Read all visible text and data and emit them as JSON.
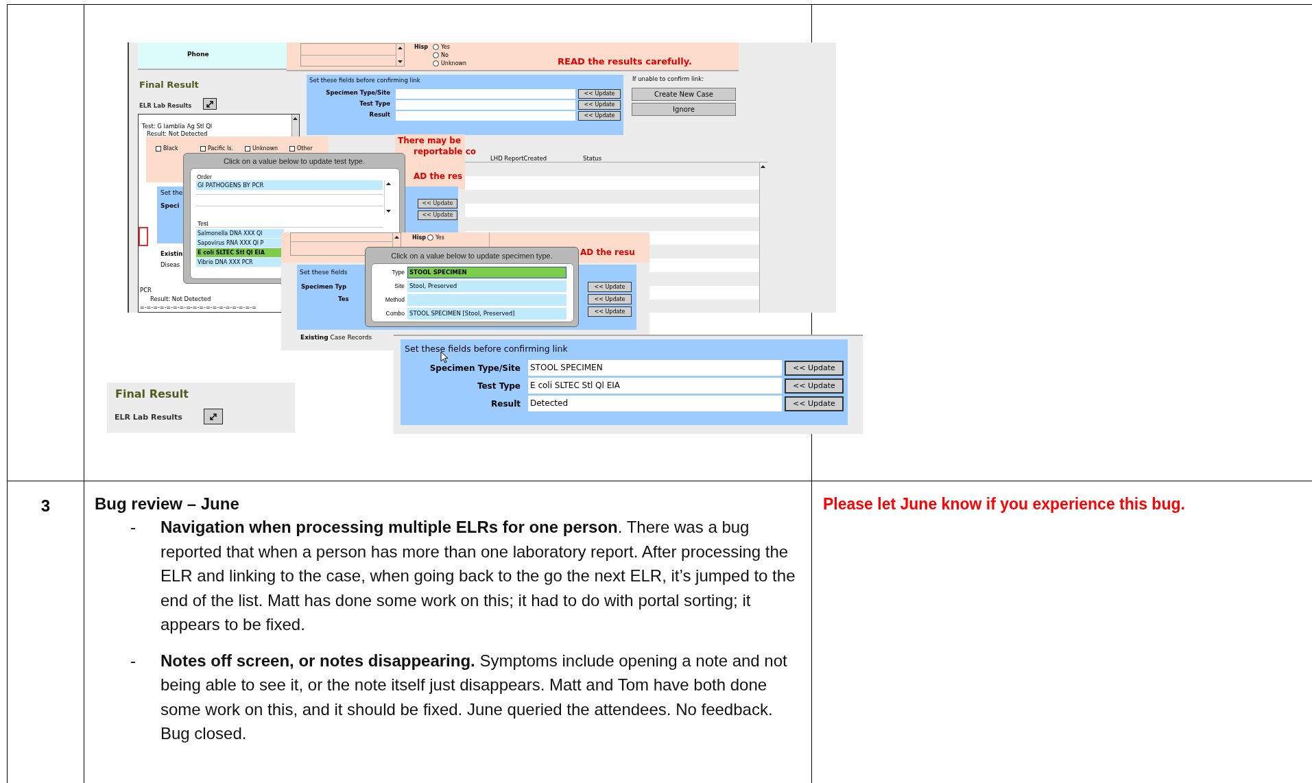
{
  "collage": {
    "back_screen": {
      "phone_label": "Phone",
      "hisp": {
        "label": "Hisp",
        "options": [
          {
            "label": "Yes",
            "selected": false
          },
          {
            "label": "No",
            "selected": false
          },
          {
            "label": "Unknown",
            "selected": false
          }
        ]
      },
      "warning": "READ the results carefully.",
      "final_result": "Final Result",
      "elr_label": "ELR Lab Results",
      "elr_list_top": [
        "Test: G lamblia Ag Stl Ql",
        "Result: Not Detected"
      ],
      "race_options": [
        {
          "label": "Black",
          "checked": false
        },
        {
          "label": "Pacific Is.",
          "checked": false
        },
        {
          "label": "Unknown",
          "checked": false
        },
        {
          "label": "Other",
          "checked": false
        }
      ],
      "elr_list_bottom": [
        "PCR",
        "Result: Not Detected"
      ],
      "separator": "=-=-=-=-=-=-=-=-=-=-=-=-=-=-=-=-=-=",
      "confirm_panel": {
        "title": "Set these fields before confirming link",
        "rows": [
          {
            "label": "Specimen Type/Site",
            "button": "<< Update"
          },
          {
            "label": "Test Type",
            "button": "<< Update"
          },
          {
            "label": "Result",
            "button": "<< Update"
          }
        ]
      },
      "unable_label": "If unable to confirm link:",
      "actions": [
        "Create New Case",
        "Ignore"
      ],
      "alert_lines": [
        "There may be",
        "reportable co",
        "AD the res"
      ],
      "hidden_panel": {
        "title": "Set the",
        "label": "Speci",
        "buttons": [
          "<< Update",
          "<< Update"
        ]
      },
      "case_labels": [
        "Existin",
        "Diseas"
      ],
      "columns": [
        "LHD ReportCreated",
        "Status"
      ]
    },
    "test_popup": {
      "title": "Click on a value below to update test type.",
      "order_label": "Order",
      "orders": [
        "GI PATHOGENS BY PCR"
      ],
      "test_label": "Test",
      "tests": [
        {
          "label": "Salmonella DNA XXX Ql",
          "selected": false
        },
        {
          "label": "Sapovirus RNA XXX Ql P",
          "selected": false
        },
        {
          "label": "E coli SLTEC Stl Ql EIA",
          "selected": true
        },
        {
          "label": "Vibrio DNA XXX PCR",
          "selected": false
        }
      ]
    },
    "second_screen": {
      "hisp": {
        "label": "Hisp",
        "option": {
          "label": "Yes",
          "selected": false
        }
      },
      "alert": "AD the resu",
      "panel": {
        "title": "Set these fields",
        "labels": [
          "Specimen Typ",
          "Tes"
        ],
        "buttons": [
          "<< Update",
          "<< Update",
          "<< Update"
        ]
      },
      "existing": "**Existing** Case Records"
    },
    "specimen_popup": {
      "title": "Click on a value below to update specimen type.",
      "rows": [
        {
          "label": "Type",
          "value": "STOOL SPECIMEN",
          "selected": true
        },
        {
          "label": "Site",
          "value": "Stool, Preserved",
          "selected": false
        },
        {
          "label": "Method",
          "selected": false
        },
        {
          "label": "Combo",
          "value": "STOOL SPECIMEN [Stool, Preserved]",
          "selected": false
        }
      ]
    },
    "final_result_box": {
      "title": "Final Result",
      "elr_label": "ELR Lab Results"
    },
    "front_panel": {
      "title": "Set these fields before confirming link",
      "rows": [
        {
          "label": "Specimen Type/Site",
          "value": "STOOL SPECIMEN",
          "button": "<< Update"
        },
        {
          "label": "Test Type",
          "value": "E coli SLTEC Stl Ql EIA",
          "button": "<< Update"
        },
        {
          "label": "Result",
          "value": "Detected",
          "button": "<< Update"
        }
      ]
    }
  },
  "agenda": {
    "number": "3",
    "heading": "Bug review – June",
    "items": [
      {
        "marker": "-",
        "text": "**Navigation when processing multiple ELRs for one person**. There was a bug reported that when a person has more than one laboratory report. After processing the ELR and linking to the case, when going back to the go the next ELR, it’s jumped to the end of the list. Matt has done some work on this; it had to do with portal sorting; it appears to be fixed."
      },
      {
        "marker": "-",
        "text": "**Notes off screen, or notes disappearing.** Symptoms include opening a note and not being able to see it, or the note itself just disappears. Matt and Tom have both done some work on this, and it should be fixed. June queried the attendees. No feedback. Bug closed."
      }
    ],
    "note": "Please let June know if you experience this bug."
  }
}
